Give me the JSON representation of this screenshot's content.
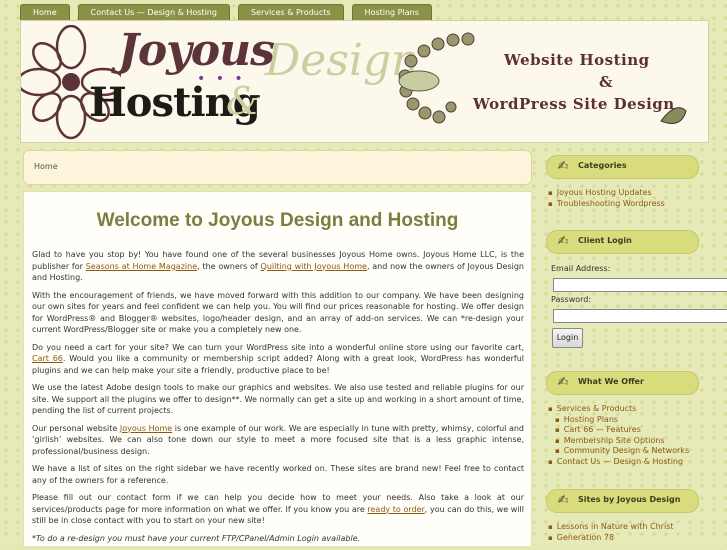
{
  "nav": [
    "Home",
    "Contact Us — Design & Hosting",
    "Services & Products",
    "Hosting Plans"
  ],
  "header": {
    "logo_joyous": "Joyous",
    "logo_hosting": "Hosting",
    "logo_amp": "&",
    "logo_design": "Design",
    "logo_dots": "• • •",
    "tagline_1": "Website Hosting",
    "tagline_2": "&",
    "tagline_3": "WordPress Site Design"
  },
  "breadcrumb": "Home",
  "main": {
    "title": "Welcome to Joyous Design and Hosting",
    "p1": {
      "a": "Glad to have you stop by!  You have found one of the several businesses Joyous Home owns.  Joyous Home LLC, is the publisher for ",
      "link1": "Seasons at Home Magazine",
      "b": ", the owners of ",
      "link2": "Quilting with Joyous Home",
      "c": ", and now the owners of Joyous Design and Hosting."
    },
    "p2": "With the encouragement of friends, we have moved forward with this addition to our company.  We have been designing our own sites for years and feel confident we can help you.  You will find our prices reasonable for hosting.  We offer design for WordPress® and Blogger® websites, logo/header design, and an array of add-on services.  We can *re-design your current WordPress/Blogger site or make you a completely new one.",
    "p3": {
      "a": "Do you need a cart for your site?  We can turn your WordPress site into a wonderful online store using our favorite cart, ",
      "link": "Cart 66",
      "b": ". Would you like a community or membership script added?  Along with a great look, WordPress has wonderful plugins and we can help make your site a friendly, productive place to be!"
    },
    "p4": "We use the latest Adobe design tools to make our graphics and websites.  We also use tested and reliable plugins for our site.  We support all the plugins we offer to design**.  We normally can get a site up and working in a short amount of time, pending the list of current projects.",
    "p5": {
      "a": "Our personal website ",
      "link": "Joyous Home",
      "b": " is one example of our work.  We are especially in tune with pretty, whimsy, colorful and ‘girlish’ websites.  We can also tone down our style to meet a more focused site that is a less graphic intense, professional/business design."
    },
    "p6": "We have a list of sites on the right sidebar we have recently worked on.  These sites are brand new!  Feel free to contact any of the owners for a reference.",
    "p7": {
      "a": "Please fill out our contact form if we can help you decide how to meet your needs. Also take a look at our services/products page for more information on what we offer.  If you know you are ",
      "link": "ready to order",
      "b": ", you can do this, we will still be in close contact with you to start on your new site!"
    },
    "note": "*To do a re-design you must have your current FTP/CPanel/Admin Login available."
  },
  "sidebar": {
    "categories": {
      "title": "Categories",
      "items": [
        "Joyous Hosting Updates",
        "Troubleshooting Wordpress"
      ]
    },
    "login": {
      "title": "Client Login",
      "email_label": "Email Address:",
      "email_value": "",
      "password_label": "Password:",
      "password_value": "",
      "button": "Login"
    },
    "offer": {
      "title": "What We Offer",
      "items": [
        "Services & Products",
        "Hosting Plans",
        "Cart 66 — Features",
        "Membership Site Options",
        "Community Design & Networks",
        "Contact Us — Design & Hosting"
      ]
    },
    "sites": {
      "title": "Sites by Joyous Design",
      "items": [
        "Lessons in Nature with Christ",
        "Generation 78"
      ]
    },
    "icon": "hand-writing-icon"
  },
  "colors": {
    "nav_tab": "#8c9147",
    "sidebar_head": "#d8dc7c",
    "title": "#7d7d42",
    "link": "#8c5a10",
    "logo_maroon": "#5c3338"
  }
}
